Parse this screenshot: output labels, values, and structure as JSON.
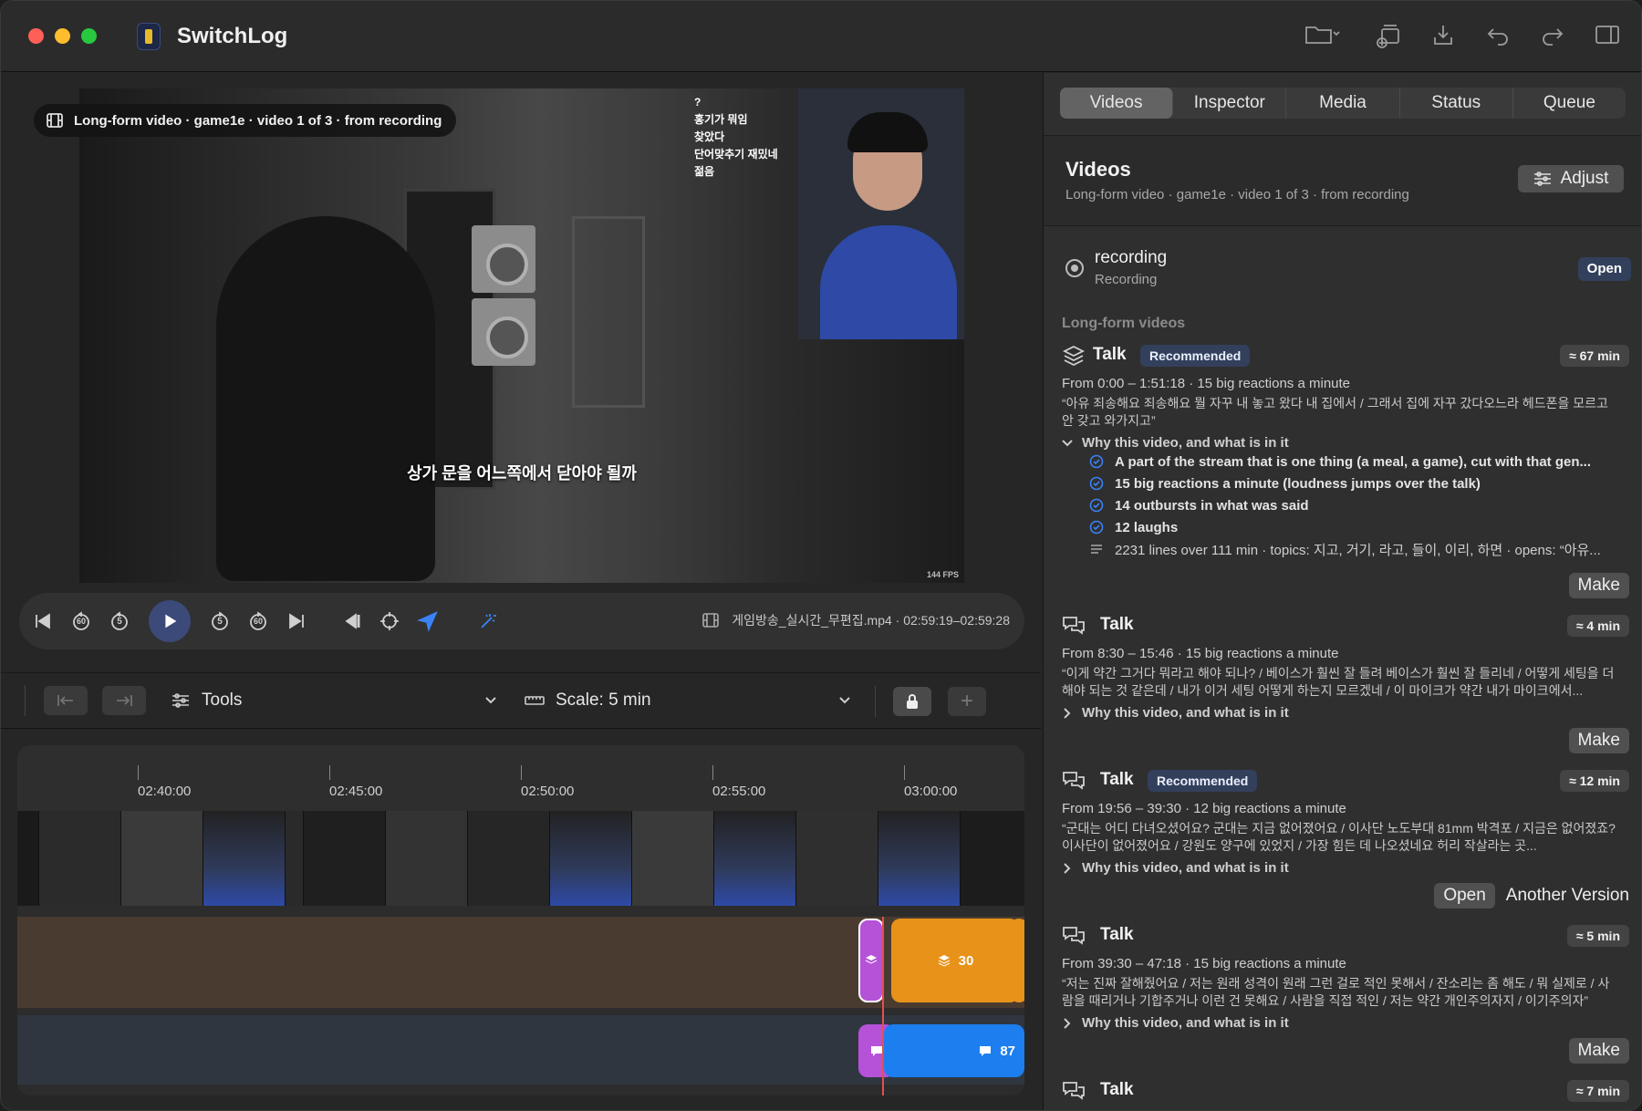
{
  "app": {
    "title": "SwitchLog"
  },
  "player": {
    "badge": "Long-form video · game1e · video 1 of 3 · from recording",
    "subtitle": "상가 문을 어느쪽에서 닫아야 될까",
    "chat_lines": [
      "?",
      "홍기가 뭐임",
      "찾았다",
      "단어맞추기 재밌네",
      "젊음"
    ],
    "fps": "144 FPS",
    "file_info": "게임방송_실시간_무편집.mp4 · 02:59:19–02:59:28",
    "skip_back_label": "60",
    "step_back_label": "5",
    "step_fwd_label": "5",
    "skip_fwd_label": "60"
  },
  "toolbar": {
    "tools_label": "Tools",
    "scale_label": "Scale: 5 min"
  },
  "timeline": {
    "ticks": [
      "02:40:00",
      "02:45:00",
      "02:50:00",
      "02:55:00",
      "03:00:00"
    ],
    "clip_talk_count": "30",
    "clip_chat_count": "87"
  },
  "right": {
    "tabs": [
      "Videos",
      "Inspector",
      "Media",
      "Status",
      "Queue"
    ],
    "title": "Videos",
    "subtitle": "Long-form video · game1e · video 1 of 3 · from recording",
    "adjust_label": "Adjust",
    "recording": {
      "name": "recording",
      "sub": "Recording",
      "open_label": "Open"
    },
    "section_label": "Long-form videos",
    "cards": [
      {
        "title": "Talk",
        "badge": "Recommended",
        "duration": "≈ 67 min",
        "meta": "From 0:00 – 1:51:18 · 15 big reactions a minute",
        "quote": "“아유 죄송해요 죄송해요 뭘 자꾸 내 놓고 왔다 내 집에서 / 그래서 집에 자꾸 갔다오느라 헤드폰을 모르고 안 갖고 와가지고”",
        "why": "Why this video, and what is in it",
        "reasons": [
          "A part of the stream that is one thing (a meal, a game), cut with that gen...",
          "15 big reactions a minute (loudness jumps over the talk)",
          "14 outbursts in what was said",
          "12 laughs"
        ],
        "lines_info": "2231 lines over 111 min · topics: 지고, 거기, 라고, 들이, 이리, 하면 · opens: “아유...",
        "action": "Make"
      },
      {
        "title": "Talk",
        "duration": "≈ 4 min",
        "meta": "From 8:30 – 15:46 · 15 big reactions a minute",
        "quote": "“이게 약간 그거다 뭐라고 해야 되나? / 베이스가 훨씬 잘 들려 베이스가 훨씬 잘 들리네 / 어떻게 세팅을 더 해야 되는 것 같은데 / 내가 이거 세팅 어떻게 하는지 모르겠네 / 이 마이크가 약간 내가 마이크에서...",
        "why": "Why this video, and what is in it",
        "action": "Make"
      },
      {
        "title": "Talk",
        "badge": "Recommended",
        "duration": "≈ 12 min",
        "meta": "From 19:56 – 39:30 · 12 big reactions a minute",
        "quote": "“군대는 어디 다녀오셨어요? 군대는 지금 없어졌어요 / 이사단 노도부대 81mm 박격포 / 지금은 없어졌죠? 이사단이 없어졌어요 / 강원도 양구에 있었지 / 가장 힘든 데 나오셨네요 허리 작살라는 곳...",
        "why": "Why this video, and what is in it",
        "action": "Open",
        "action2": "Another Version"
      },
      {
        "title": "Talk",
        "duration": "≈ 5 min",
        "meta": "From 39:30 – 47:18 · 15 big reactions a minute",
        "quote": "“저는 진짜 잘해줬어요 / 저는 원래 성격이 원래 그런 걸로 적인 못해서 / 잔소리는 좀 해도 / 뭐 실제로 / 사람을 때리거나 기합주거나 이런 건 못해요 / 사람을 직접 적인 / 저는 약간 개인주의자지 / 이기주의자”",
        "why": "Why this video, and what is in it",
        "action": "Make"
      },
      {
        "title": "Talk",
        "duration": "≈ 7 min"
      }
    ]
  }
}
